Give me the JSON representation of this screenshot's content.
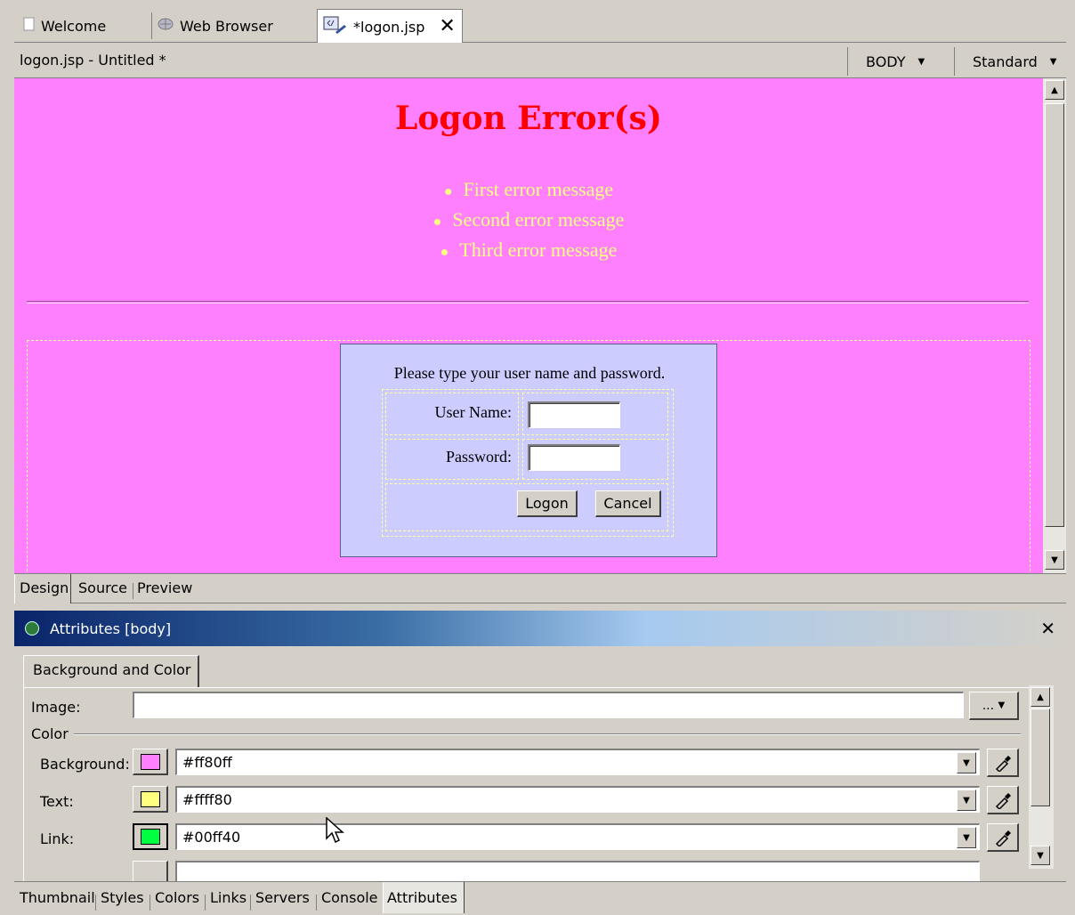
{
  "editor_tabs": [
    {
      "label": "Welcome",
      "icon": "page-icon"
    },
    {
      "label": "Web Browser",
      "icon": "globe-icon"
    },
    {
      "label": "*logon.jsp",
      "icon": "jsp-file-icon",
      "active": true
    }
  ],
  "doc_title": "logon.jsp - Untitled *",
  "tag_combo": "BODY",
  "mode_combo": "Standard",
  "design_page": {
    "heading": "Logon Error(s)",
    "errors": [
      "First error message",
      "Second error message",
      "Third error message"
    ],
    "prompt": "Please type your user name and password.",
    "username_label": "User Name:",
    "password_label": "Password:",
    "logon_button": "Logon",
    "cancel_button": "Cancel"
  },
  "mode_tabs": [
    "Design",
    "Source",
    "Preview"
  ],
  "attributes": {
    "header": "Attributes [body]",
    "subtab": "Background and Color",
    "image_label": "Image:",
    "image_value": "",
    "image_button": "...",
    "color_group": "Color",
    "background_label": "Background:",
    "background_value": "#ff80ff",
    "text_label": "Text:",
    "text_value": "#ffff80",
    "link_label": "Link:",
    "link_value": "#00ff40"
  },
  "view_tabs": [
    "Thumbnail",
    "Styles",
    "Colors",
    "Links",
    "Servers",
    "Console",
    "Attributes"
  ],
  "colors": {
    "page_background": "#ff80ff",
    "page_text": "#ffff80",
    "link": "#00ff40",
    "heading": "#ff0000",
    "form_background": "#ccccff"
  }
}
